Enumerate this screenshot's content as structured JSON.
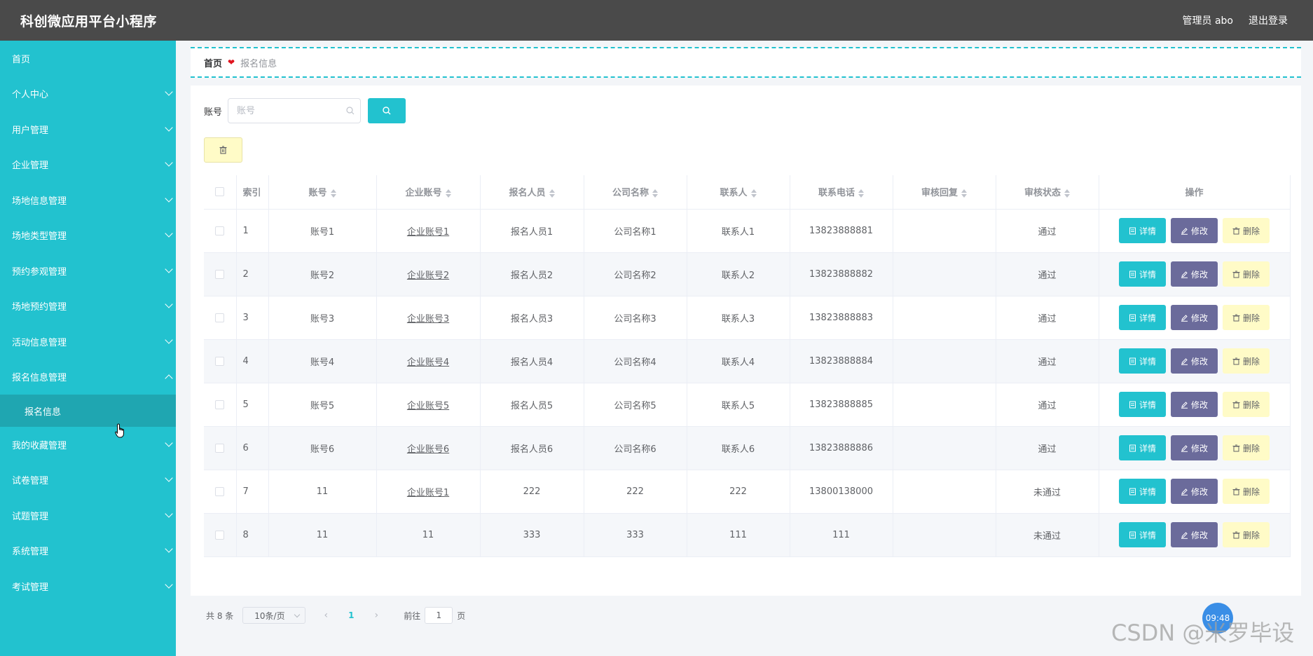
{
  "header": {
    "title": "科创微应用平台小程序",
    "user_label": "管理员 abo",
    "logout_label": "退出登录"
  },
  "sidebar": {
    "items": [
      {
        "label": "首页",
        "expandable": false
      },
      {
        "label": "个人中心",
        "expandable": true
      },
      {
        "label": "用户管理",
        "expandable": true
      },
      {
        "label": "企业管理",
        "expandable": true
      },
      {
        "label": "场地信息管理",
        "expandable": true
      },
      {
        "label": "场地类型管理",
        "expandable": true
      },
      {
        "label": "预约参观管理",
        "expandable": true
      },
      {
        "label": "场地预约管理",
        "expandable": true
      },
      {
        "label": "活动信息管理",
        "expandable": true
      },
      {
        "label": "报名信息管理",
        "expandable": true,
        "expanded": true
      },
      {
        "label": "报名信息",
        "sub": true
      },
      {
        "label": "我的收藏管理",
        "expandable": true
      },
      {
        "label": "试卷管理",
        "expandable": true
      },
      {
        "label": "试题管理",
        "expandable": true
      },
      {
        "label": "系统管理",
        "expandable": true
      },
      {
        "label": "考试管理",
        "expandable": true
      }
    ]
  },
  "breadcrumb": {
    "home": "首页",
    "separator": "❤",
    "current": "报名信息"
  },
  "search": {
    "label": "账号",
    "placeholder": "账号"
  },
  "table": {
    "headers": [
      "",
      "索引",
      "账号",
      "企业账号",
      "报名人员",
      "公司名称",
      "联系人",
      "联系电话",
      "审核回复",
      "审核状态",
      "操作"
    ],
    "rows": [
      [
        "1",
        "账号1",
        "企业账号1",
        "报名人员1",
        "公司名称1",
        "联系人1",
        "13823888881",
        "",
        "通过"
      ],
      [
        "2",
        "账号2",
        "企业账号2",
        "报名人员2",
        "公司名称2",
        "联系人2",
        "13823888882",
        "",
        "通过"
      ],
      [
        "3",
        "账号3",
        "企业账号3",
        "报名人员3",
        "公司名称3",
        "联系人3",
        "13823888883",
        "",
        "通过"
      ],
      [
        "4",
        "账号4",
        "企业账号4",
        "报名人员4",
        "公司名称4",
        "联系人4",
        "13823888884",
        "",
        "通过"
      ],
      [
        "5",
        "账号5",
        "企业账号5",
        "报名人员5",
        "公司名称5",
        "联系人5",
        "13823888885",
        "",
        "通过"
      ],
      [
        "6",
        "账号6",
        "企业账号6",
        "报名人员6",
        "公司名称6",
        "联系人6",
        "13823888886",
        "",
        "通过"
      ],
      [
        "7",
        "11",
        "企业账号1",
        "222",
        "222",
        "222",
        "13800138000",
        "",
        "未通过"
      ],
      [
        "8",
        "11",
        "11",
        "333",
        "333",
        "111",
        "111",
        "",
        "未通过"
      ]
    ],
    "actions": {
      "detail": "详情",
      "edit": "修改",
      "delete": "删除"
    }
  },
  "pagination": {
    "total": "共 8 条",
    "page_size": "10条/页",
    "current_page": "1",
    "goto_prefix": "前往",
    "goto_value": "1",
    "goto_suffix": "页"
  },
  "overlay": {
    "clock": "09:48",
    "watermark": "CSDN @米罗毕设"
  },
  "colors": {
    "accent": "#22c2cf",
    "topbar": "#4a4a4a",
    "edit": "#6b6b9b",
    "delete": "#fffbc7"
  }
}
